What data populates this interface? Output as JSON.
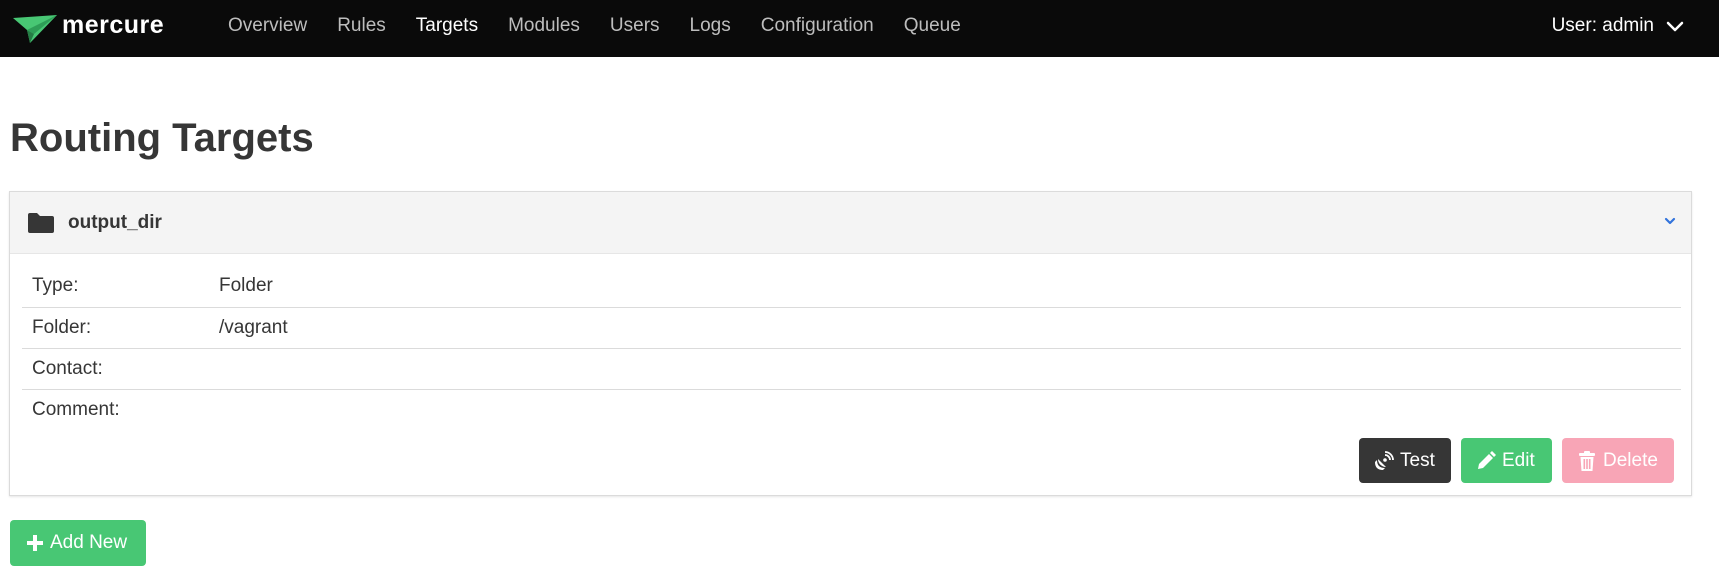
{
  "navbar": {
    "brand": "mercure",
    "items": [
      {
        "label": "Overview",
        "active": false
      },
      {
        "label": "Rules",
        "active": false
      },
      {
        "label": "Targets",
        "active": true
      },
      {
        "label": "Modules",
        "active": false
      },
      {
        "label": "Users",
        "active": false
      },
      {
        "label": "Logs",
        "active": false
      },
      {
        "label": "Configuration",
        "active": false
      },
      {
        "label": "Queue",
        "active": false
      }
    ],
    "user_label": "User: admin",
    "user_icon": "chevron-down-icon"
  },
  "page": {
    "title": "Routing Targets"
  },
  "target": {
    "icon": "folder-icon",
    "name": "output_dir",
    "expand_icon": "angle-down-icon",
    "fields": [
      {
        "label": "Type:",
        "value": "Folder"
      },
      {
        "label": "Folder:",
        "value": "/vagrant"
      },
      {
        "label": "Contact:",
        "value": ""
      },
      {
        "label": "Comment:",
        "value": ""
      }
    ],
    "actions": {
      "test_label": "Test",
      "edit_label": "Edit",
      "delete_label": "Delete"
    }
  },
  "add_new_label": "Add New",
  "colors": {
    "navbar_bg": "#0a0a0a",
    "brand_green": "#48c774",
    "dark_button": "#363636",
    "delete_disabled": "#f8a5b6",
    "card_header_bg": "#f4f4f4",
    "link_blue": "#3273dc"
  }
}
